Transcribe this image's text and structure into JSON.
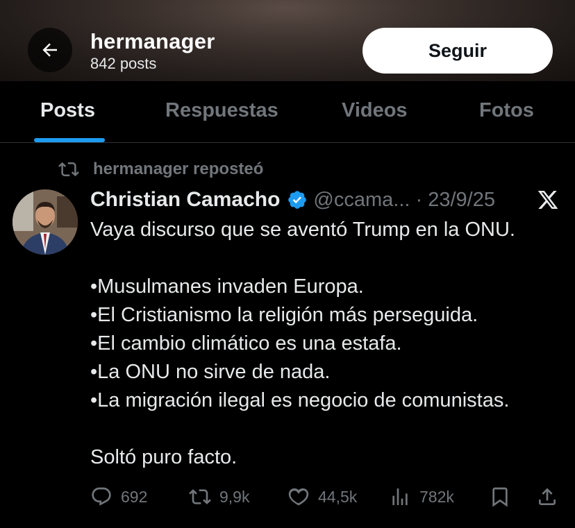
{
  "header": {
    "title": "hermanager",
    "post_count": "842 posts",
    "follow_label": "Seguir"
  },
  "tabs": [
    {
      "label": "Posts",
      "active": true
    },
    {
      "label": "Respuestas",
      "active": false
    },
    {
      "label": "Videos",
      "active": false
    },
    {
      "label": "Fotos",
      "active": false
    }
  ],
  "post": {
    "repost_label": "hermanager reposteó",
    "author_name": "Christian Camacho",
    "handle_date": "@ccama... · 23/9/25",
    "lines": [
      "Vaya discurso que se aventó Trump en la ONU.",
      "•Musulmanes invaden Europa.",
      "•El Cristianismo la religión más perseguida.",
      "•El cambio climático es una estafa.",
      "•La ONU no sirve de nada.",
      "•La migración ilegal es negocio de comunistas.",
      "Soltó puro facto."
    ],
    "stats": {
      "replies": "692",
      "reposts": "9,9k",
      "likes": "44,5k",
      "views": "782k"
    }
  },
  "colors": {
    "accent": "#1d9bf0",
    "background": "#000000",
    "muted": "#71767b",
    "text": "#e7e9ea"
  },
  "icons": [
    "back-arrow-icon",
    "repost-icon",
    "verified-badge-icon",
    "x-logo-icon",
    "reply-icon",
    "like-icon",
    "views-icon",
    "bookmark-icon",
    "share-icon"
  ]
}
